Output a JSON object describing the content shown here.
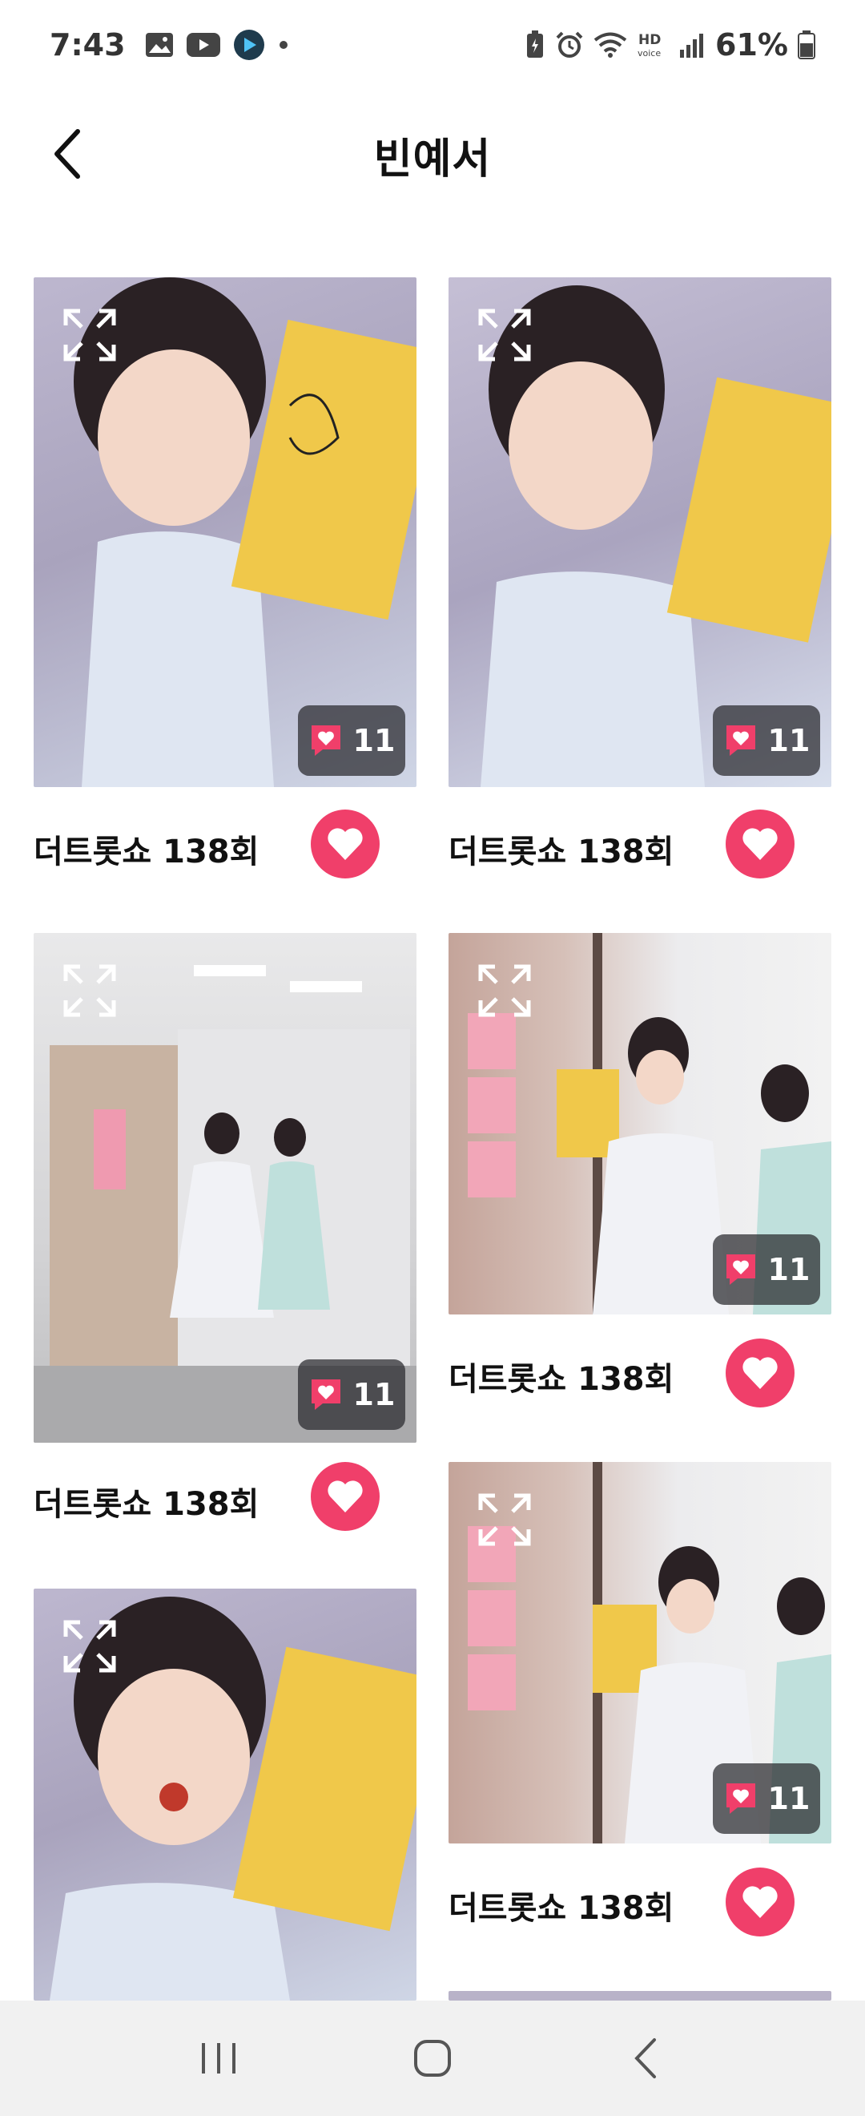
{
  "status_bar": {
    "time": "7:43",
    "battery": "61%",
    "left_icons": [
      "gallery-icon",
      "youtube-icon",
      "play-store-icon",
      "dot-icon"
    ],
    "right_icons": [
      "battery-saver-icon",
      "alarm-icon",
      "wifi-icon",
      "hd-voice-icon",
      "signal-icon",
      "battery-icon"
    ]
  },
  "header": {
    "title": "빈예서",
    "back_icon": "chevron-left-icon"
  },
  "cards": [
    {
      "title": "더트롯쇼 138회",
      "likes": "11"
    },
    {
      "title": "더트롯쇼 138회",
      "likes": "11"
    },
    {
      "title": "더트롯쇼 138회",
      "likes": "11"
    },
    {
      "title": "더트롯쇼 138회",
      "likes": "11"
    },
    {
      "title": "더트롯쇼 138회",
      "likes": "11"
    }
  ],
  "nav_bar": {
    "icons": [
      "recent-apps-icon",
      "home-icon",
      "back-icon"
    ]
  },
  "colors": {
    "accent_pink": "#f03f6a",
    "badge_bg": "#28282c",
    "nav_bg": "#f1f1f1"
  }
}
